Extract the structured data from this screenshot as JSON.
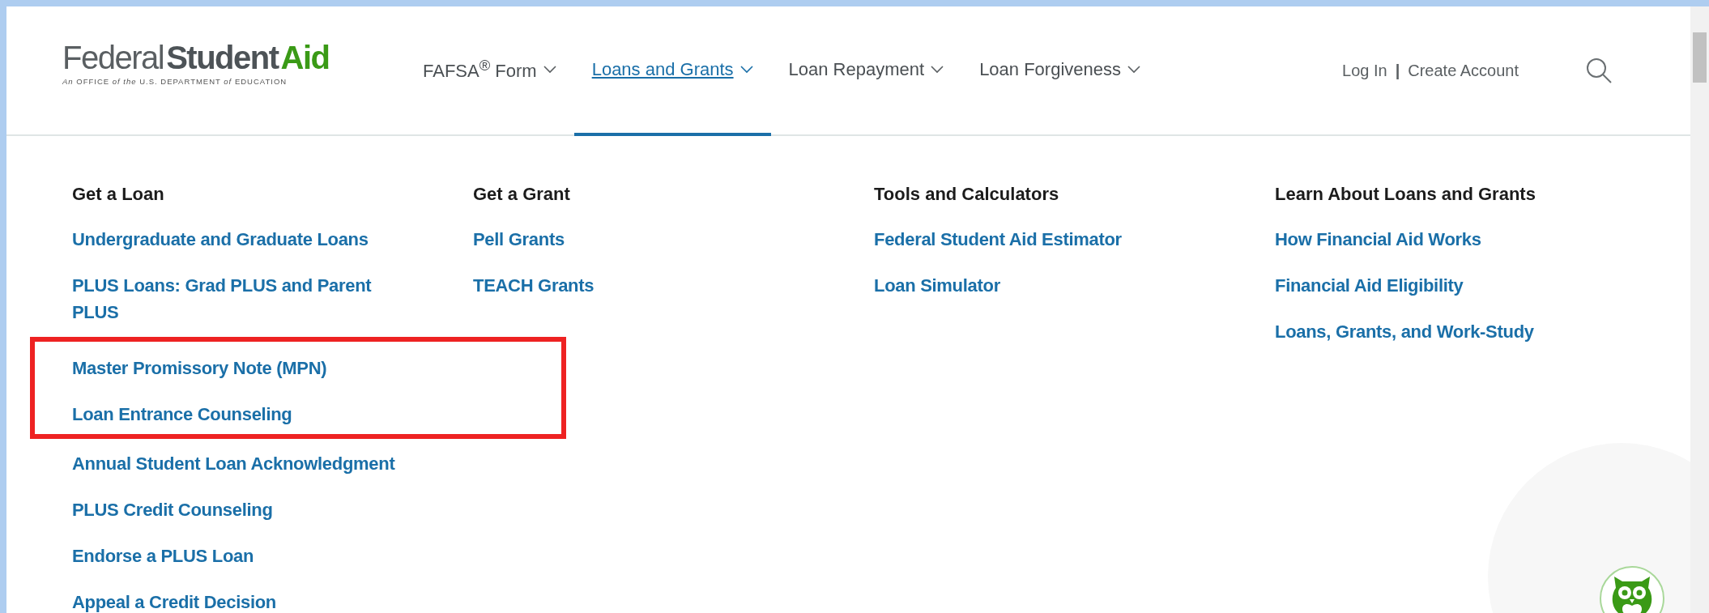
{
  "logo": {
    "words": [
      {
        "text": "Federal",
        "kind": "light"
      },
      {
        "text": "Student",
        "kind": "bold"
      },
      {
        "text": "Aid",
        "kind": "accent"
      }
    ],
    "subtitle": "*An* OFFICE *of the* U.S. DEPARTMENT *of* EDUCATION"
  },
  "nav": [
    {
      "label": "FAFSA$^{®}$ Form",
      "selected": false
    },
    {
      "label": "Loans and Grants",
      "selected": true
    },
    {
      "label": "Loan Repayment",
      "selected": false
    },
    {
      "label": "Loan Forgiveness",
      "selected": false
    }
  ],
  "account": {
    "login": "Log In",
    "separator": "|",
    "create": "Create Account"
  },
  "menu": [
    {
      "heading": "Get a Loan",
      "entries": [
        {
          "kind": "link",
          "text": "Undergraduate and Graduate Loans"
        },
        {
          "kind": "link",
          "text": "PLUS Loans: Grad PLUS and Parent PLUS"
        },
        {
          "kind": "highlight_frame",
          "links": [
            "Master Promissory Note (MPN)",
            "Loan Entrance Counseling"
          ]
        },
        {
          "kind": "link",
          "text": "Annual Student Loan Acknowledgment"
        },
        {
          "kind": "link",
          "text": "PLUS Credit Counseling"
        },
        {
          "kind": "link",
          "text": "Endorse a PLUS Loan"
        },
        {
          "kind": "link",
          "text": "Appeal a Credit Decision"
        }
      ]
    },
    {
      "heading": "Get a Grant",
      "entries": [
        {
          "kind": "link",
          "text": "Pell Grants"
        },
        {
          "kind": "link",
          "text": "TEACH Grants"
        }
      ]
    },
    {
      "heading": "Tools and Calculators",
      "entries": [
        {
          "kind": "link",
          "text": "Federal Student Aid Estimator"
        },
        {
          "kind": "link",
          "text": "Loan Simulator"
        }
      ]
    },
    {
      "heading": "Learn About Loans and Grants",
      "entries": [
        {
          "kind": "link",
          "text": "How Financial Aid Works"
        },
        {
          "kind": "link",
          "text": "Financial Aid Eligibility"
        },
        {
          "kind": "link",
          "text": "Loans, Grants, and Work-Study"
        }
      ]
    }
  ]
}
